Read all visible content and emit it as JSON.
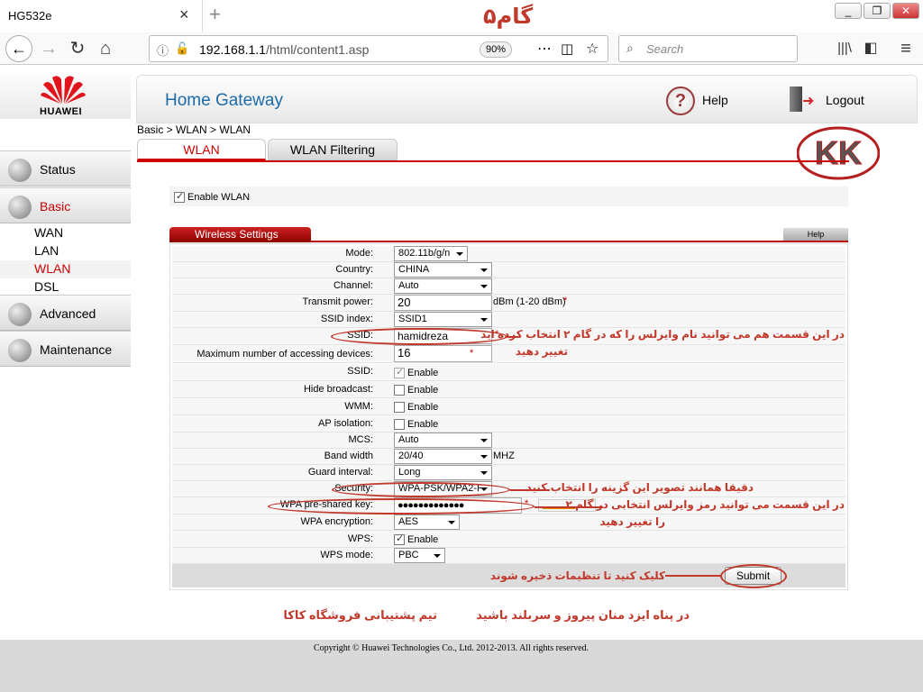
{
  "browser": {
    "tab_title": "HG532e",
    "close_tab": "×",
    "new_tab": "+",
    "step_label": "گام۵",
    "url_host": "192.168.1.1",
    "url_path": "/html/content1.asp",
    "zoom": "90%",
    "search_placeholder": "Search",
    "window_buttons": [
      "_",
      "❐",
      "✕"
    ]
  },
  "header": {
    "brand": "HUAWEI",
    "title": "Home Gateway",
    "help_label": "Help",
    "logout_label": "Logout"
  },
  "sidebar": {
    "items": [
      {
        "label": "Status"
      },
      {
        "label": "Basic",
        "active": true
      },
      {
        "label": "Advanced"
      },
      {
        "label": "Maintenance"
      }
    ],
    "sub_items": [
      "WAN",
      "LAN",
      "WLAN",
      "DSL"
    ]
  },
  "breadcrumb": "Basic > WLAN > WLAN",
  "tabs": [
    "WLAN",
    "WLAN Filtering"
  ],
  "enable_wlan_label": "Enable WLAN",
  "wireless": {
    "title": "Wireless Settings",
    "help": "Help",
    "rows": [
      {
        "label": "Mode:",
        "value": "802.11b/g/n"
      },
      {
        "label": "Country:",
        "value": "CHINA"
      },
      {
        "label": "Channel:",
        "value": "Auto"
      },
      {
        "label": "Transmit power:",
        "value": "20",
        "unit": "dBm (1-20 dBm)",
        "required": "*"
      },
      {
        "label": "SSID index:",
        "value": "SSID1"
      },
      {
        "label": "SSID:",
        "value": "hamidreza",
        "required": "*"
      },
      {
        "label": "Maximum number of accessing devices:",
        "value": "16",
        "required": "*"
      },
      {
        "label": "SSID:",
        "value": "Enable"
      },
      {
        "label": "Hide broadcast:",
        "value": "Enable"
      },
      {
        "label": "WMM:",
        "value": "Enable"
      },
      {
        "label": "AP isolation:",
        "value": "Enable"
      },
      {
        "label": "MCS:",
        "value": "Auto"
      },
      {
        "label": "Band width",
        "value": "20/40",
        "unit": "MHZ"
      },
      {
        "label": "Guard interval:",
        "value": "Long"
      },
      {
        "label": "Security:",
        "value": "WPA-PSK/WPA2-F"
      },
      {
        "label": "WPA pre-shared key:",
        "value": "●●●●●●●●●●●●●",
        "required": "*"
      },
      {
        "label": "WPA encryption:",
        "value": "AES"
      },
      {
        "label": "WPS:",
        "value": "Enable"
      },
      {
        "label": "WPS mode:",
        "value": "PBC"
      }
    ],
    "submit": "Submit"
  },
  "notes": {
    "ssid": "در این قسمت هم می توانید نام وایرلس را که در گام ۲ انتخاب کرده اید",
    "ssid2": "تغییر دهید",
    "security": "دقیقا همانند تصویر این گزینه را انتخاب کنید",
    "psk": "در این قسمت می توانید رمز وایرلس انتخابی در گام ۲",
    "psk2": "را تغییر دهید",
    "submit": "کلیک کنید تا تنظیمات ذخیره شوند",
    "bottom_right": "در پناه ایزد منان پیروز و سربلند باشید",
    "bottom_left": "تیم پشتیبانی فروشگاه کاکا"
  },
  "footer": {
    "copyright": "Copyright © Huawei Technologies Co., Ltd. 2012-2013. All rights reserved."
  },
  "colors": {
    "accent": "#cc0000",
    "title_blue": "#1d6ba7",
    "annotation": "#c0392b"
  }
}
